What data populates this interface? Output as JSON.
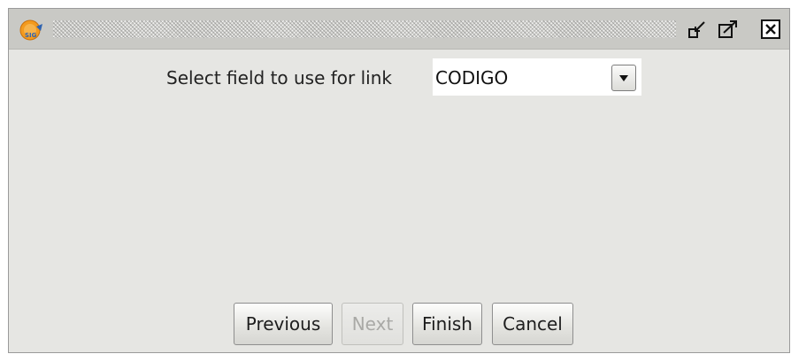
{
  "window": {
    "app_icon": "gvsig-logo-icon",
    "title_buttons": [
      "minimize-icon",
      "maximize-icon",
      "close-icon"
    ]
  },
  "form": {
    "field_label": "Select field to use for link",
    "field_value": "CODIGO",
    "dropdown_icon": "chevron-down-icon"
  },
  "buttons": {
    "previous": "Previous",
    "next": "Next",
    "finish": "Finish",
    "cancel": "Cancel",
    "next_enabled": false
  },
  "colors": {
    "background": "#e6e6e3",
    "logo_orange": "#f39a1e",
    "logo_blue": "#2f63b0"
  }
}
